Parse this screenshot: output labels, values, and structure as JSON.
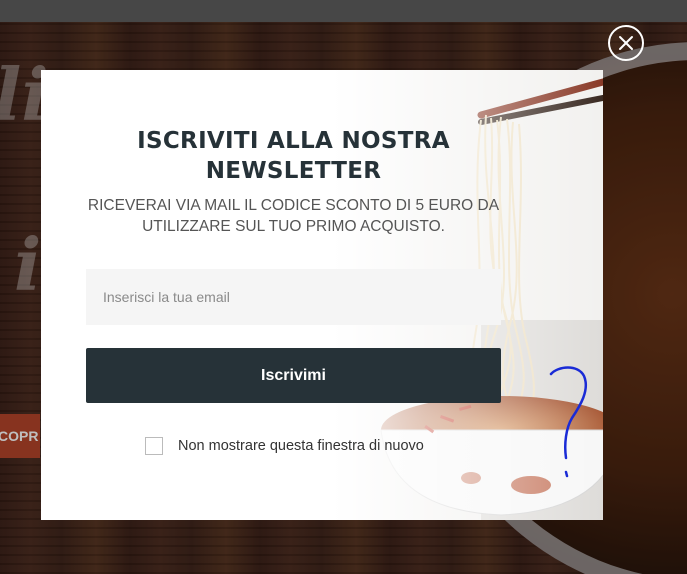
{
  "modal": {
    "title": "ISCRIVITI ALLA NOSTRA NEWSLETTER",
    "subtitle": "RICEVERAI VIA MAIL IL CODICE SCONTO DI 5 EURO DA UTILIZZARE SUL TUO PRIMO ACQUISTO.",
    "email_placeholder": "Inserisci la tua email",
    "email_value": "",
    "submit_label": "Iscrivimi",
    "dont_show_label": "Non mostrare questa finestra di nuovo",
    "dont_show_checked": false
  },
  "background": {
    "partial_heading_1": "lie",
    "partial_heading_2": "i",
    "partial_button_label": "COPR"
  },
  "icons": {
    "close": "close-icon",
    "scribble": "question-mark-annotation"
  },
  "colors": {
    "button": "#263238",
    "title": "#263238",
    "input_bg": "#f5f5f5",
    "background_accent": "#b5452a"
  }
}
